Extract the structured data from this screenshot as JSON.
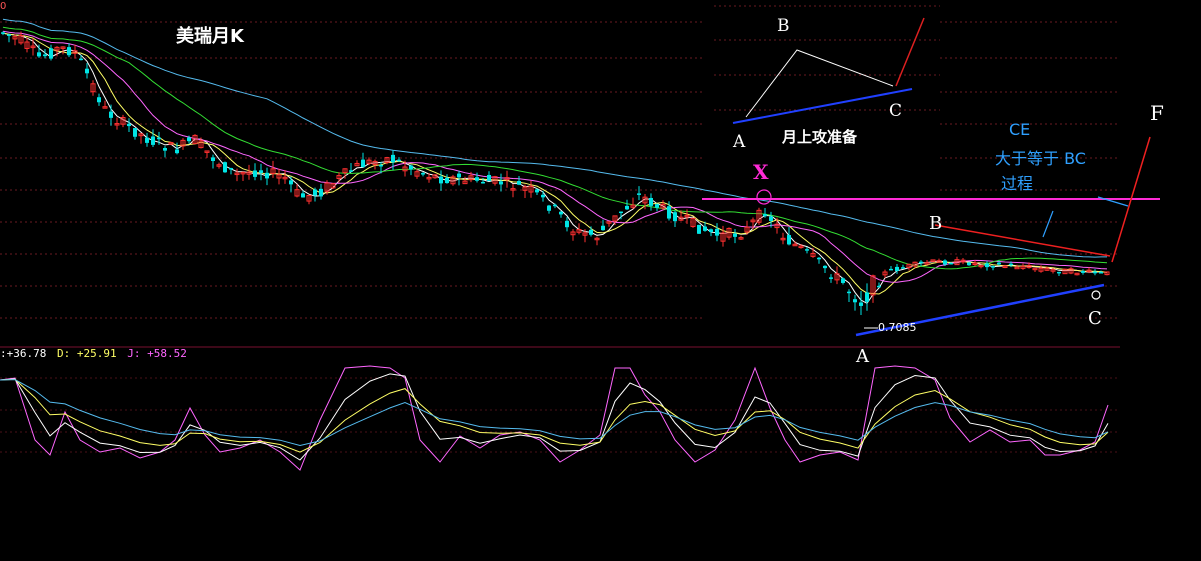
{
  "title": "美瑞月K",
  "top_axis_fragment": "0",
  "price_low_marker": "0.7085",
  "kdj": {
    "k_label": ":+36.78",
    "d_label": "D: +25.91",
    "j_label": "J: +58.52",
    "k": 36.78,
    "d": 25.91,
    "j": 58.52
  },
  "colors": {
    "up": "#ff3030",
    "down": "#00e5e5",
    "ma5": "#ffffff",
    "ma10": "#ffff66",
    "ma20": "#ff66ff",
    "ma30": "#33dd33",
    "ma60": "#55bbee",
    "k_line": "#ffffff",
    "d_line": "#ffff66",
    "j_line": "#ff66ff"
  },
  "inset": {
    "label_a": "A",
    "label_b": "B",
    "label_c": "C",
    "caption": "月上攻准备"
  },
  "annotations": {
    "x": "X",
    "a": "A",
    "b": "B",
    "c": "C",
    "f": "F",
    "ce_line1": "CE",
    "ce_line2": "大于等于 BC",
    "ce_line3": "过程"
  },
  "chart_data": {
    "type": "candlestick",
    "title": "美瑞月K",
    "series": [
      {
        "name": "Price",
        "pattern": "downtrend then consolidation",
        "key_points": [
          {
            "label": "X",
            "role": "swing high"
          },
          {
            "label": "A",
            "role": "swing low",
            "value": 0.7085
          },
          {
            "label": "B",
            "role": "lower high"
          },
          {
            "label": "C",
            "role": "higher low"
          },
          {
            "label": "F",
            "role": "projected target"
          }
        ]
      },
      {
        "name": "KDJ",
        "values": {
          "K": 36.78,
          "D": 25.91,
          "J": 58.52
        }
      }
    ]
  }
}
